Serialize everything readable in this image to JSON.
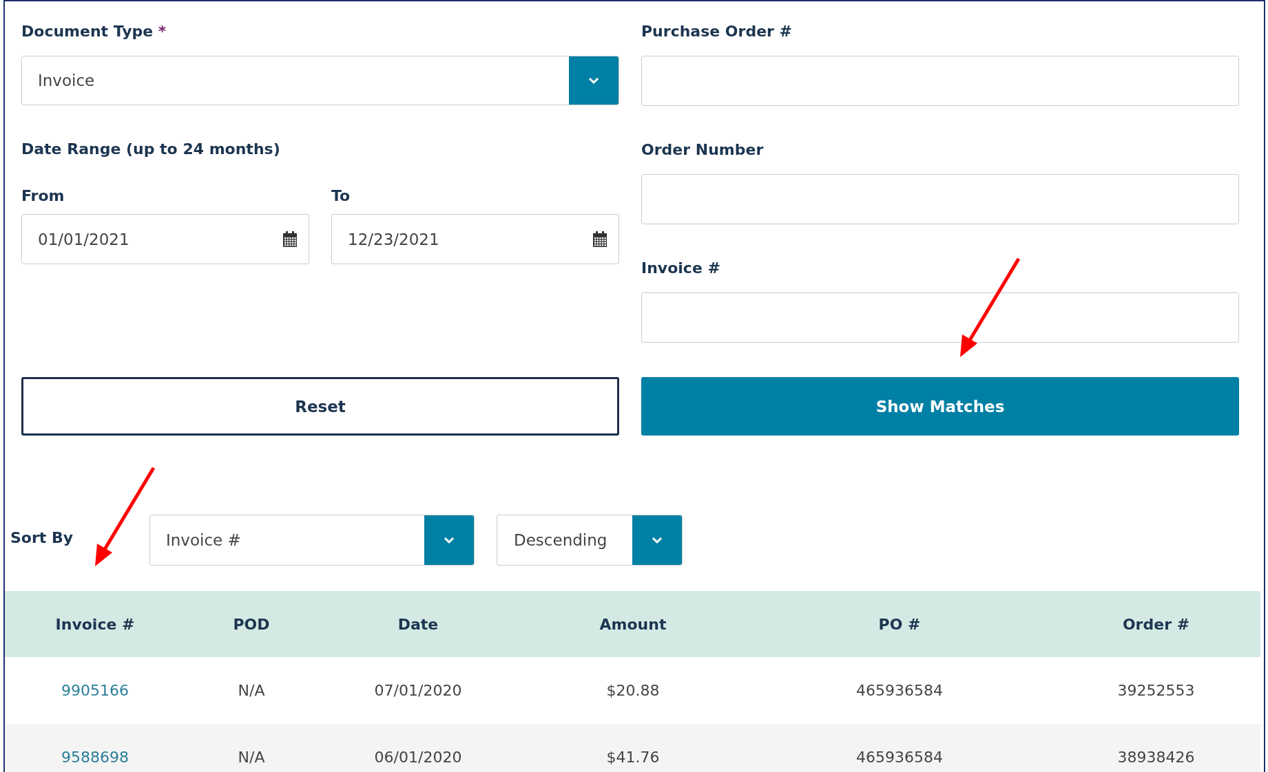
{
  "document_type": {
    "label": "Document Type",
    "required_mark": "*",
    "value": "Invoice"
  },
  "date_range": {
    "label": "Date Range (up to 24 months)",
    "from": {
      "label": "From",
      "value": "01/01/2021"
    },
    "to": {
      "label": "To",
      "value": "12/23/2021"
    }
  },
  "purchase_order": {
    "label": "Purchase Order #"
  },
  "order_number": {
    "label": "Order Number"
  },
  "invoice": {
    "label": "Invoice #"
  },
  "buttons": {
    "reset": "Reset",
    "show_matches": "Show Matches"
  },
  "sort": {
    "label": "Sort By",
    "field": "Invoice #",
    "direction": "Descending"
  },
  "table": {
    "columns": [
      "Invoice #",
      "POD",
      "Date",
      "Amount",
      "PO #",
      "Order #"
    ],
    "rows": [
      [
        "9905166",
        "N/A",
        "07/01/2020",
        "$20.88",
        "465936584",
        "39252553"
      ],
      [
        "9588698",
        "N/A",
        "06/01/2020",
        "$41.76",
        "465936584",
        "38938426"
      ]
    ]
  }
}
